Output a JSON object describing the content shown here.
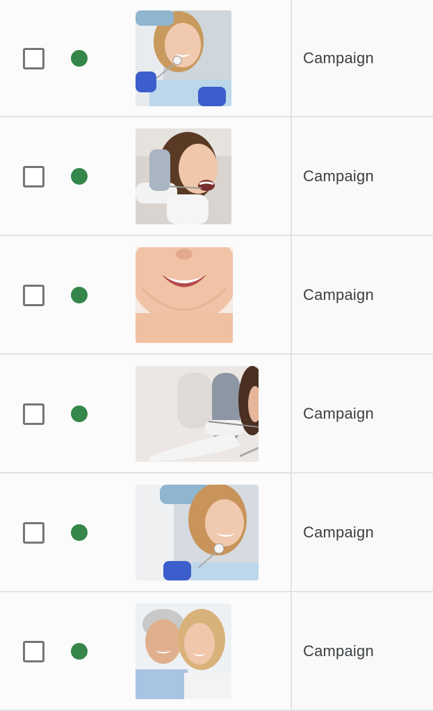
{
  "colors": {
    "status_active": "#34864a",
    "row_border": "#e2e3e5",
    "checkbox_border": "#757575"
  },
  "rows": [
    {
      "selected": false,
      "status": "active",
      "image": "dentist-patient-smiling-photo",
      "type_label": "Campaign"
    },
    {
      "selected": false,
      "status": "active",
      "image": "dental-exam-woman-photo",
      "type_label": "Campaign"
    },
    {
      "selected": false,
      "status": "active",
      "image": "white-smile-closeup-photo",
      "type_label": "Campaign"
    },
    {
      "selected": false,
      "status": "active",
      "image": "dental-tools-gloved-hands-photo",
      "type_label": "Campaign"
    },
    {
      "selected": false,
      "status": "active",
      "image": "dentist-patient-smiling-photo",
      "type_label": "Campaign"
    },
    {
      "selected": false,
      "status": "active",
      "image": "smiling-senior-couple-photo",
      "type_label": "Campaign"
    }
  ]
}
